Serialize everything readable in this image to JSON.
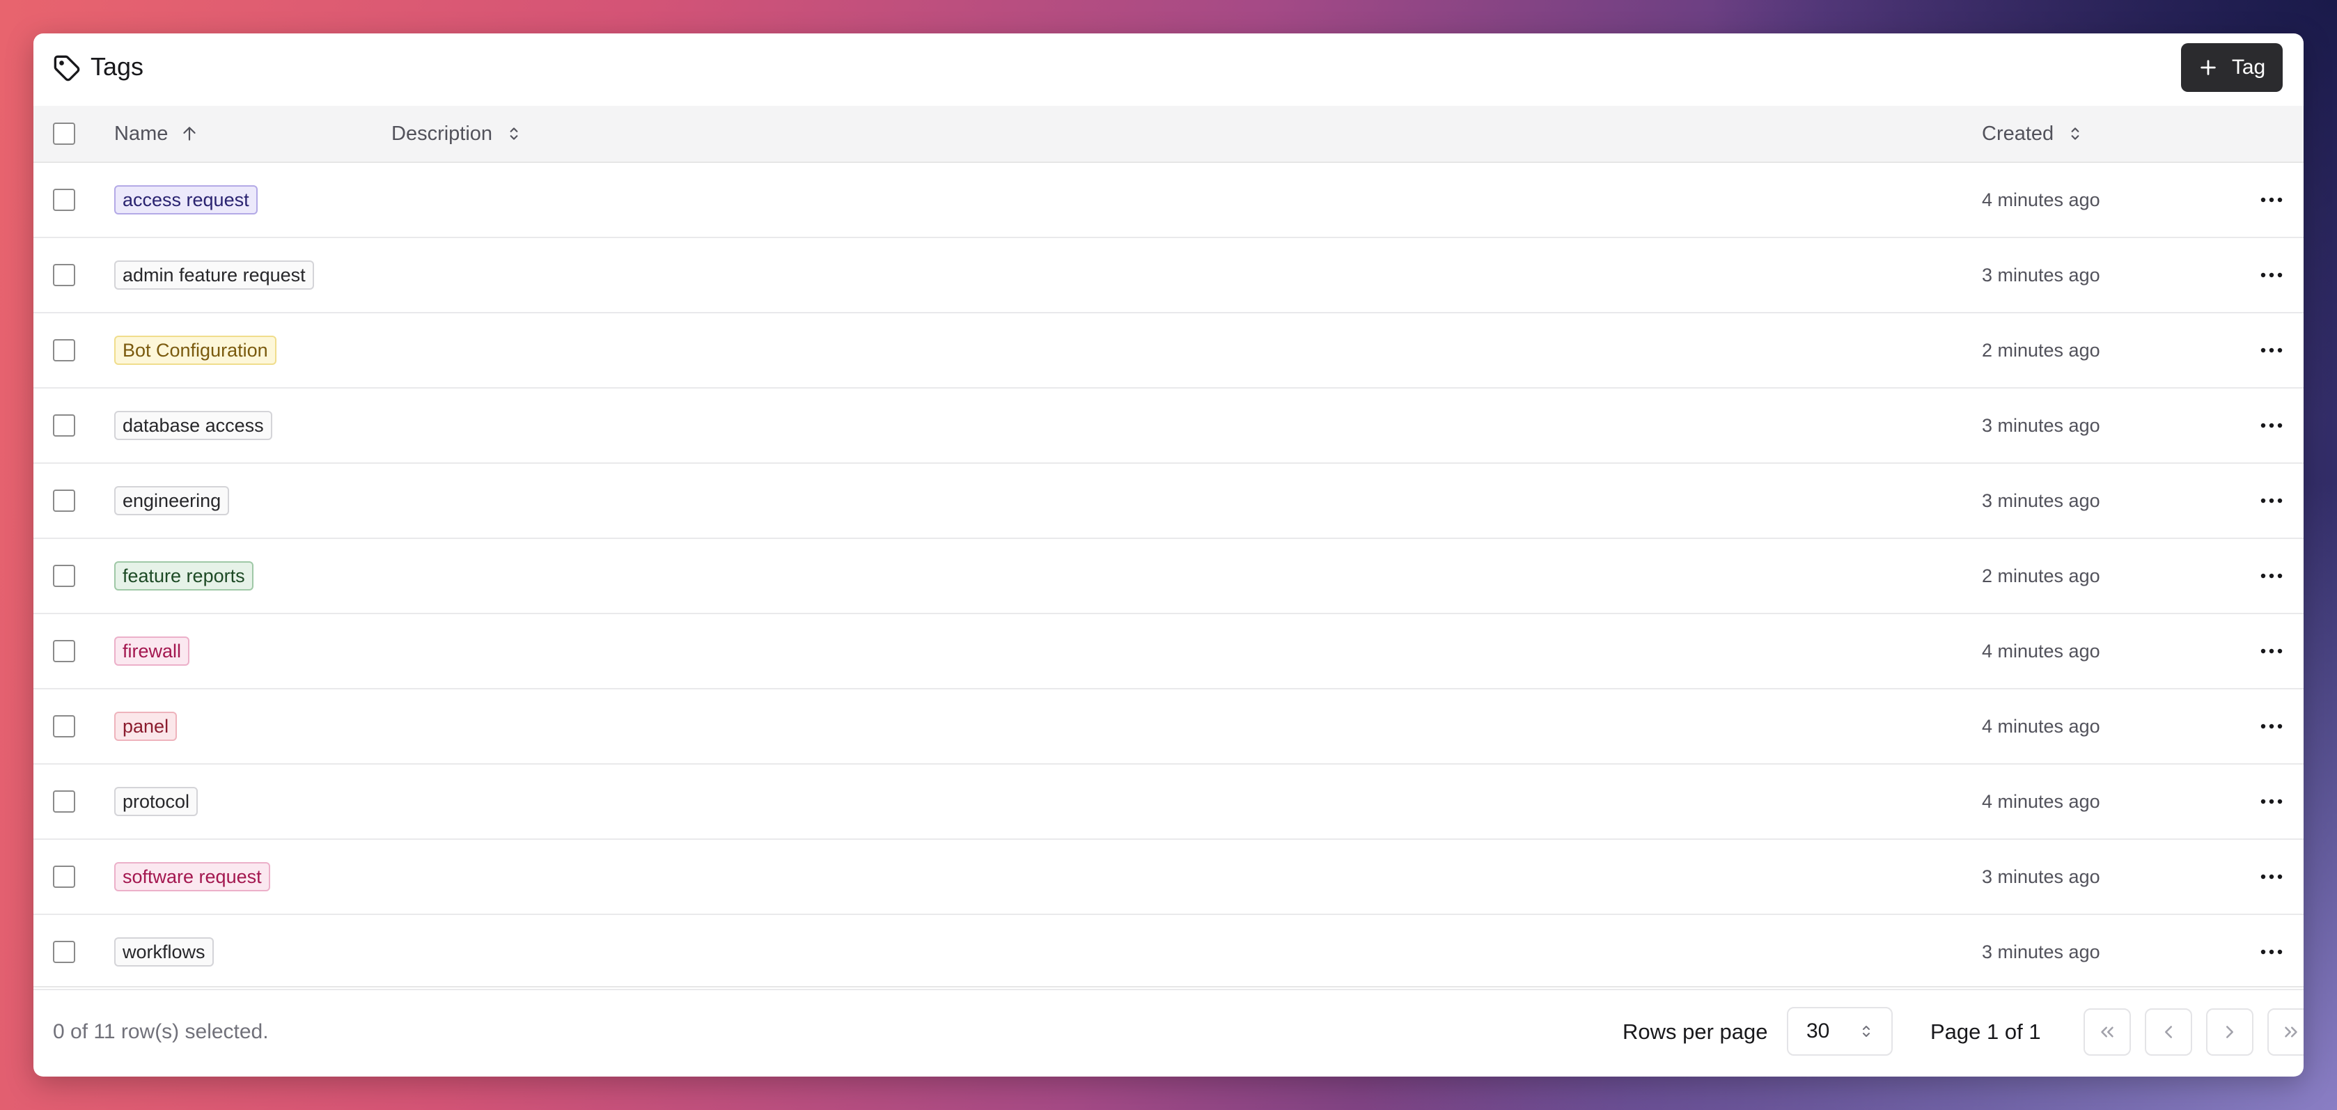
{
  "header": {
    "title": "Tags",
    "add_button_label": "Tag"
  },
  "table": {
    "columns": {
      "name": "Name",
      "description": "Description",
      "created": "Created"
    },
    "rows": [
      {
        "name": "access request",
        "color": "purple",
        "created": "4 minutes ago"
      },
      {
        "name": "admin feature request",
        "color": "gray",
        "created": "3 minutes ago"
      },
      {
        "name": "Bot Configuration",
        "color": "yellow",
        "created": "2 minutes ago"
      },
      {
        "name": "database access",
        "color": "gray",
        "created": "3 minutes ago"
      },
      {
        "name": "engineering",
        "color": "gray",
        "created": "3 minutes ago"
      },
      {
        "name": "feature reports",
        "color": "green",
        "created": "2 minutes ago"
      },
      {
        "name": "firewall",
        "color": "pink",
        "created": "4 minutes ago"
      },
      {
        "name": "panel",
        "color": "rose",
        "created": "4 minutes ago"
      },
      {
        "name": "protocol",
        "color": "gray",
        "created": "4 minutes ago"
      },
      {
        "name": "software request",
        "color": "pink",
        "created": "3 minutes ago"
      },
      {
        "name": "workflows",
        "color": "gray",
        "created": "3 minutes ago"
      }
    ]
  },
  "footer": {
    "selection_text": "0 of 11 row(s) selected.",
    "rows_per_page_label": "Rows per page",
    "rows_per_page_value": "30",
    "page_info": "Page 1 of 1"
  },
  "colors": {
    "primary_button": "#2b2b2e",
    "header_bg": "#f4f4f5"
  },
  "icons": {
    "title": "tag-icon",
    "add": "plus-icon",
    "name_sort": "arrow-up-icon",
    "other_sort": "chevrons-up-down-icon",
    "row_actions": "more-horizontal-icon",
    "pagination": [
      "chevrons-left-icon",
      "chevron-left-icon",
      "chevron-right-icon",
      "chevrons-right-icon"
    ]
  }
}
